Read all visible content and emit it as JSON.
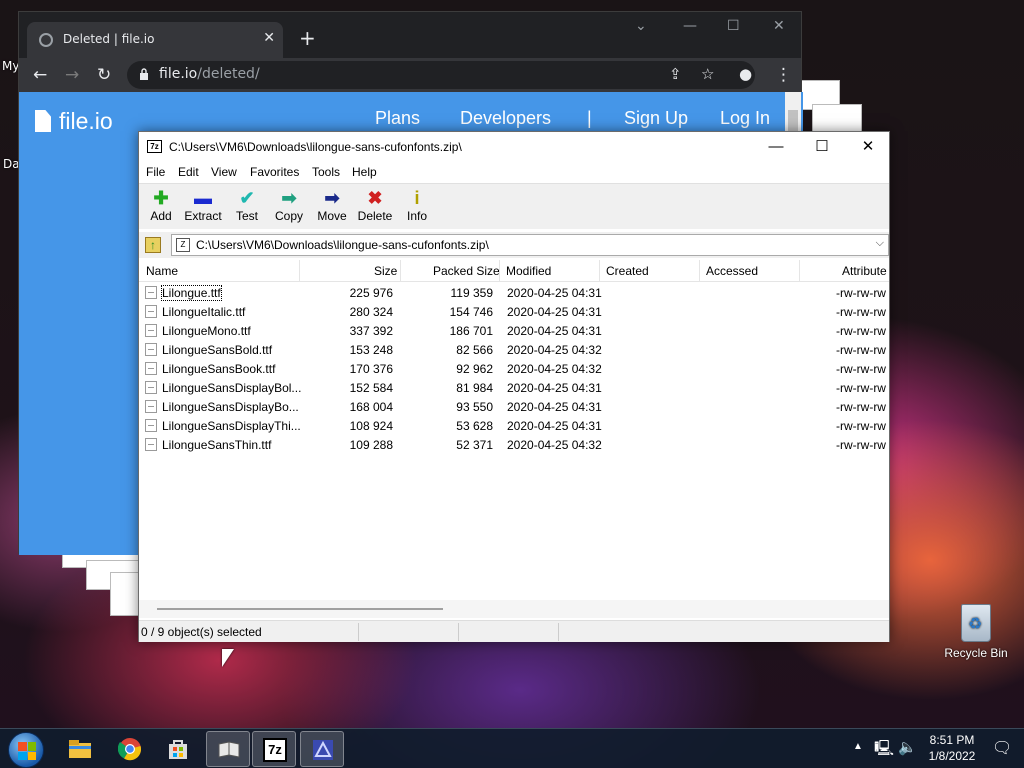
{
  "desktop": {
    "left_labels": [
      "My",
      "Da"
    ],
    "recycle_bin_label": "Recycle Bin"
  },
  "browser": {
    "tab_title": "Deleted | file.io",
    "tab_close": "✕",
    "new_tab": "+",
    "url_host": "file.io",
    "url_path": "/deleted/",
    "site": {
      "logo": "file.io",
      "nav": [
        "Plans",
        "Developers",
        "|",
        "Sign Up",
        "Log In"
      ]
    }
  },
  "sevenzip": {
    "title": "C:\\Users\\VM6\\Downloads\\lilongue-sans-cufonfonts.zip\\",
    "app_icon": "7z",
    "menu": [
      "File",
      "Edit",
      "View",
      "Favorites",
      "Tools",
      "Help"
    ],
    "toolbar": [
      {
        "label": "Add",
        "icon": "plus-icon",
        "glyph": "✚",
        "color": "#22aa22"
      },
      {
        "label": "Extract",
        "icon": "minus-icon",
        "glyph": "▬",
        "color": "#1a2ad0"
      },
      {
        "label": "Test",
        "icon": "check-icon",
        "glyph": "✔",
        "color": "#20b8b0"
      },
      {
        "label": "Copy",
        "icon": "copy-arrow-icon",
        "glyph": "➡",
        "color": "#20a080"
      },
      {
        "label": "Move",
        "icon": "move-arrow-icon",
        "glyph": "➡",
        "color": "#1a2a8a"
      },
      {
        "label": "Delete",
        "icon": "delete-x-icon",
        "glyph": "✖",
        "color": "#d02020"
      },
      {
        "label": "Info",
        "icon": "info-icon",
        "glyph": "i",
        "color": "#b0a000"
      }
    ],
    "address": "C:\\Users\\VM6\\Downloads\\lilongue-sans-cufonfonts.zip\\",
    "columns": [
      "Name",
      "Size",
      "Packed Size",
      "Modified",
      "Created",
      "Accessed",
      "Attribute"
    ],
    "files": [
      {
        "name": "Lilongue.ttf",
        "size": "225 976",
        "packed": "119 359",
        "modified": "2020-04-25 04:31",
        "attr": "-rw-rw-rw"
      },
      {
        "name": "LilongueItalic.ttf",
        "size": "280 324",
        "packed": "154 746",
        "modified": "2020-04-25 04:31",
        "attr": "-rw-rw-rw"
      },
      {
        "name": "LilongueMono.ttf",
        "size": "337 392",
        "packed": "186 701",
        "modified": "2020-04-25 04:31",
        "attr": "-rw-rw-rw"
      },
      {
        "name": "LilongueSansBold.ttf",
        "size": "153 248",
        "packed": "82 566",
        "modified": "2020-04-25 04:32",
        "attr": "-rw-rw-rw"
      },
      {
        "name": "LilongueSansBook.ttf",
        "size": "170 376",
        "packed": "92 962",
        "modified": "2020-04-25 04:32",
        "attr": "-rw-rw-rw"
      },
      {
        "name": "LilongueSansDisplayBol...",
        "size": "152 584",
        "packed": "81 984",
        "modified": "2020-04-25 04:31",
        "attr": "-rw-rw-rw"
      },
      {
        "name": "LilongueSansDisplayBo...",
        "size": "168 004",
        "packed": "93 550",
        "modified": "2020-04-25 04:31",
        "attr": "-rw-rw-rw"
      },
      {
        "name": "LilongueSansDisplayThi...",
        "size": "108 924",
        "packed": "53 628",
        "modified": "2020-04-25 04:31",
        "attr": "-rw-rw-rw"
      },
      {
        "name": "LilongueSansThin.ttf",
        "size": "109 288",
        "packed": "52 371",
        "modified": "2020-04-25 04:32",
        "attr": "-rw-rw-rw"
      }
    ],
    "status": "0 / 9 object(s) selected"
  },
  "taskbar": {
    "apps": [
      "file-explorer-icon",
      "chrome-icon",
      "store-icon",
      "app-book-icon",
      "7zip-icon",
      "app-icon"
    ],
    "app_7zip_text": "7z",
    "time": "8:51 PM",
    "date": "1/8/2022"
  }
}
